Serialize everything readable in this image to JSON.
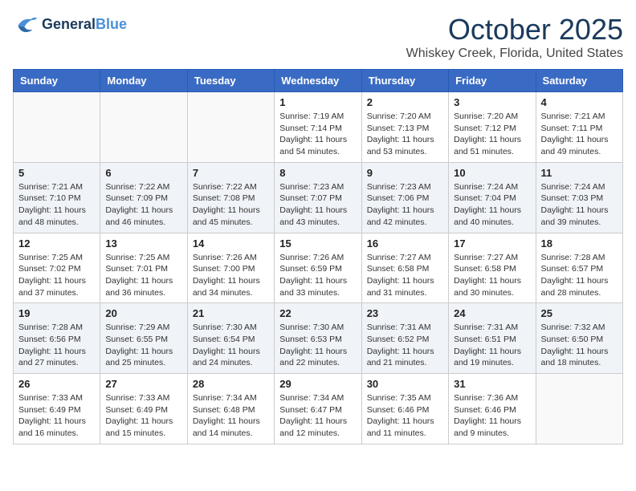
{
  "header": {
    "logo_line1": "General",
    "logo_line2": "Blue",
    "month": "October 2025",
    "location": "Whiskey Creek, Florida, United States"
  },
  "weekdays": [
    "Sunday",
    "Monday",
    "Tuesday",
    "Wednesday",
    "Thursday",
    "Friday",
    "Saturday"
  ],
  "weeks": [
    [
      {
        "day": "",
        "info": ""
      },
      {
        "day": "",
        "info": ""
      },
      {
        "day": "",
        "info": ""
      },
      {
        "day": "1",
        "info": "Sunrise: 7:19 AM\nSunset: 7:14 PM\nDaylight: 11 hours and 54 minutes."
      },
      {
        "day": "2",
        "info": "Sunrise: 7:20 AM\nSunset: 7:13 PM\nDaylight: 11 hours and 53 minutes."
      },
      {
        "day": "3",
        "info": "Sunrise: 7:20 AM\nSunset: 7:12 PM\nDaylight: 11 hours and 51 minutes."
      },
      {
        "day": "4",
        "info": "Sunrise: 7:21 AM\nSunset: 7:11 PM\nDaylight: 11 hours and 49 minutes."
      }
    ],
    [
      {
        "day": "5",
        "info": "Sunrise: 7:21 AM\nSunset: 7:10 PM\nDaylight: 11 hours and 48 minutes."
      },
      {
        "day": "6",
        "info": "Sunrise: 7:22 AM\nSunset: 7:09 PM\nDaylight: 11 hours and 46 minutes."
      },
      {
        "day": "7",
        "info": "Sunrise: 7:22 AM\nSunset: 7:08 PM\nDaylight: 11 hours and 45 minutes."
      },
      {
        "day": "8",
        "info": "Sunrise: 7:23 AM\nSunset: 7:07 PM\nDaylight: 11 hours and 43 minutes."
      },
      {
        "day": "9",
        "info": "Sunrise: 7:23 AM\nSunset: 7:06 PM\nDaylight: 11 hours and 42 minutes."
      },
      {
        "day": "10",
        "info": "Sunrise: 7:24 AM\nSunset: 7:04 PM\nDaylight: 11 hours and 40 minutes."
      },
      {
        "day": "11",
        "info": "Sunrise: 7:24 AM\nSunset: 7:03 PM\nDaylight: 11 hours and 39 minutes."
      }
    ],
    [
      {
        "day": "12",
        "info": "Sunrise: 7:25 AM\nSunset: 7:02 PM\nDaylight: 11 hours and 37 minutes."
      },
      {
        "day": "13",
        "info": "Sunrise: 7:25 AM\nSunset: 7:01 PM\nDaylight: 11 hours and 36 minutes."
      },
      {
        "day": "14",
        "info": "Sunrise: 7:26 AM\nSunset: 7:00 PM\nDaylight: 11 hours and 34 minutes."
      },
      {
        "day": "15",
        "info": "Sunrise: 7:26 AM\nSunset: 6:59 PM\nDaylight: 11 hours and 33 minutes."
      },
      {
        "day": "16",
        "info": "Sunrise: 7:27 AM\nSunset: 6:58 PM\nDaylight: 11 hours and 31 minutes."
      },
      {
        "day": "17",
        "info": "Sunrise: 7:27 AM\nSunset: 6:58 PM\nDaylight: 11 hours and 30 minutes."
      },
      {
        "day": "18",
        "info": "Sunrise: 7:28 AM\nSunset: 6:57 PM\nDaylight: 11 hours and 28 minutes."
      }
    ],
    [
      {
        "day": "19",
        "info": "Sunrise: 7:28 AM\nSunset: 6:56 PM\nDaylight: 11 hours and 27 minutes."
      },
      {
        "day": "20",
        "info": "Sunrise: 7:29 AM\nSunset: 6:55 PM\nDaylight: 11 hours and 25 minutes."
      },
      {
        "day": "21",
        "info": "Sunrise: 7:30 AM\nSunset: 6:54 PM\nDaylight: 11 hours and 24 minutes."
      },
      {
        "day": "22",
        "info": "Sunrise: 7:30 AM\nSunset: 6:53 PM\nDaylight: 11 hours and 22 minutes."
      },
      {
        "day": "23",
        "info": "Sunrise: 7:31 AM\nSunset: 6:52 PM\nDaylight: 11 hours and 21 minutes."
      },
      {
        "day": "24",
        "info": "Sunrise: 7:31 AM\nSunset: 6:51 PM\nDaylight: 11 hours and 19 minutes."
      },
      {
        "day": "25",
        "info": "Sunrise: 7:32 AM\nSunset: 6:50 PM\nDaylight: 11 hours and 18 minutes."
      }
    ],
    [
      {
        "day": "26",
        "info": "Sunrise: 7:33 AM\nSunset: 6:49 PM\nDaylight: 11 hours and 16 minutes."
      },
      {
        "day": "27",
        "info": "Sunrise: 7:33 AM\nSunset: 6:49 PM\nDaylight: 11 hours and 15 minutes."
      },
      {
        "day": "28",
        "info": "Sunrise: 7:34 AM\nSunset: 6:48 PM\nDaylight: 11 hours and 14 minutes."
      },
      {
        "day": "29",
        "info": "Sunrise: 7:34 AM\nSunset: 6:47 PM\nDaylight: 11 hours and 12 minutes."
      },
      {
        "day": "30",
        "info": "Sunrise: 7:35 AM\nSunset: 6:46 PM\nDaylight: 11 hours and 11 minutes."
      },
      {
        "day": "31",
        "info": "Sunrise: 7:36 AM\nSunset: 6:46 PM\nDaylight: 11 hours and 9 minutes."
      },
      {
        "day": "",
        "info": ""
      }
    ]
  ]
}
